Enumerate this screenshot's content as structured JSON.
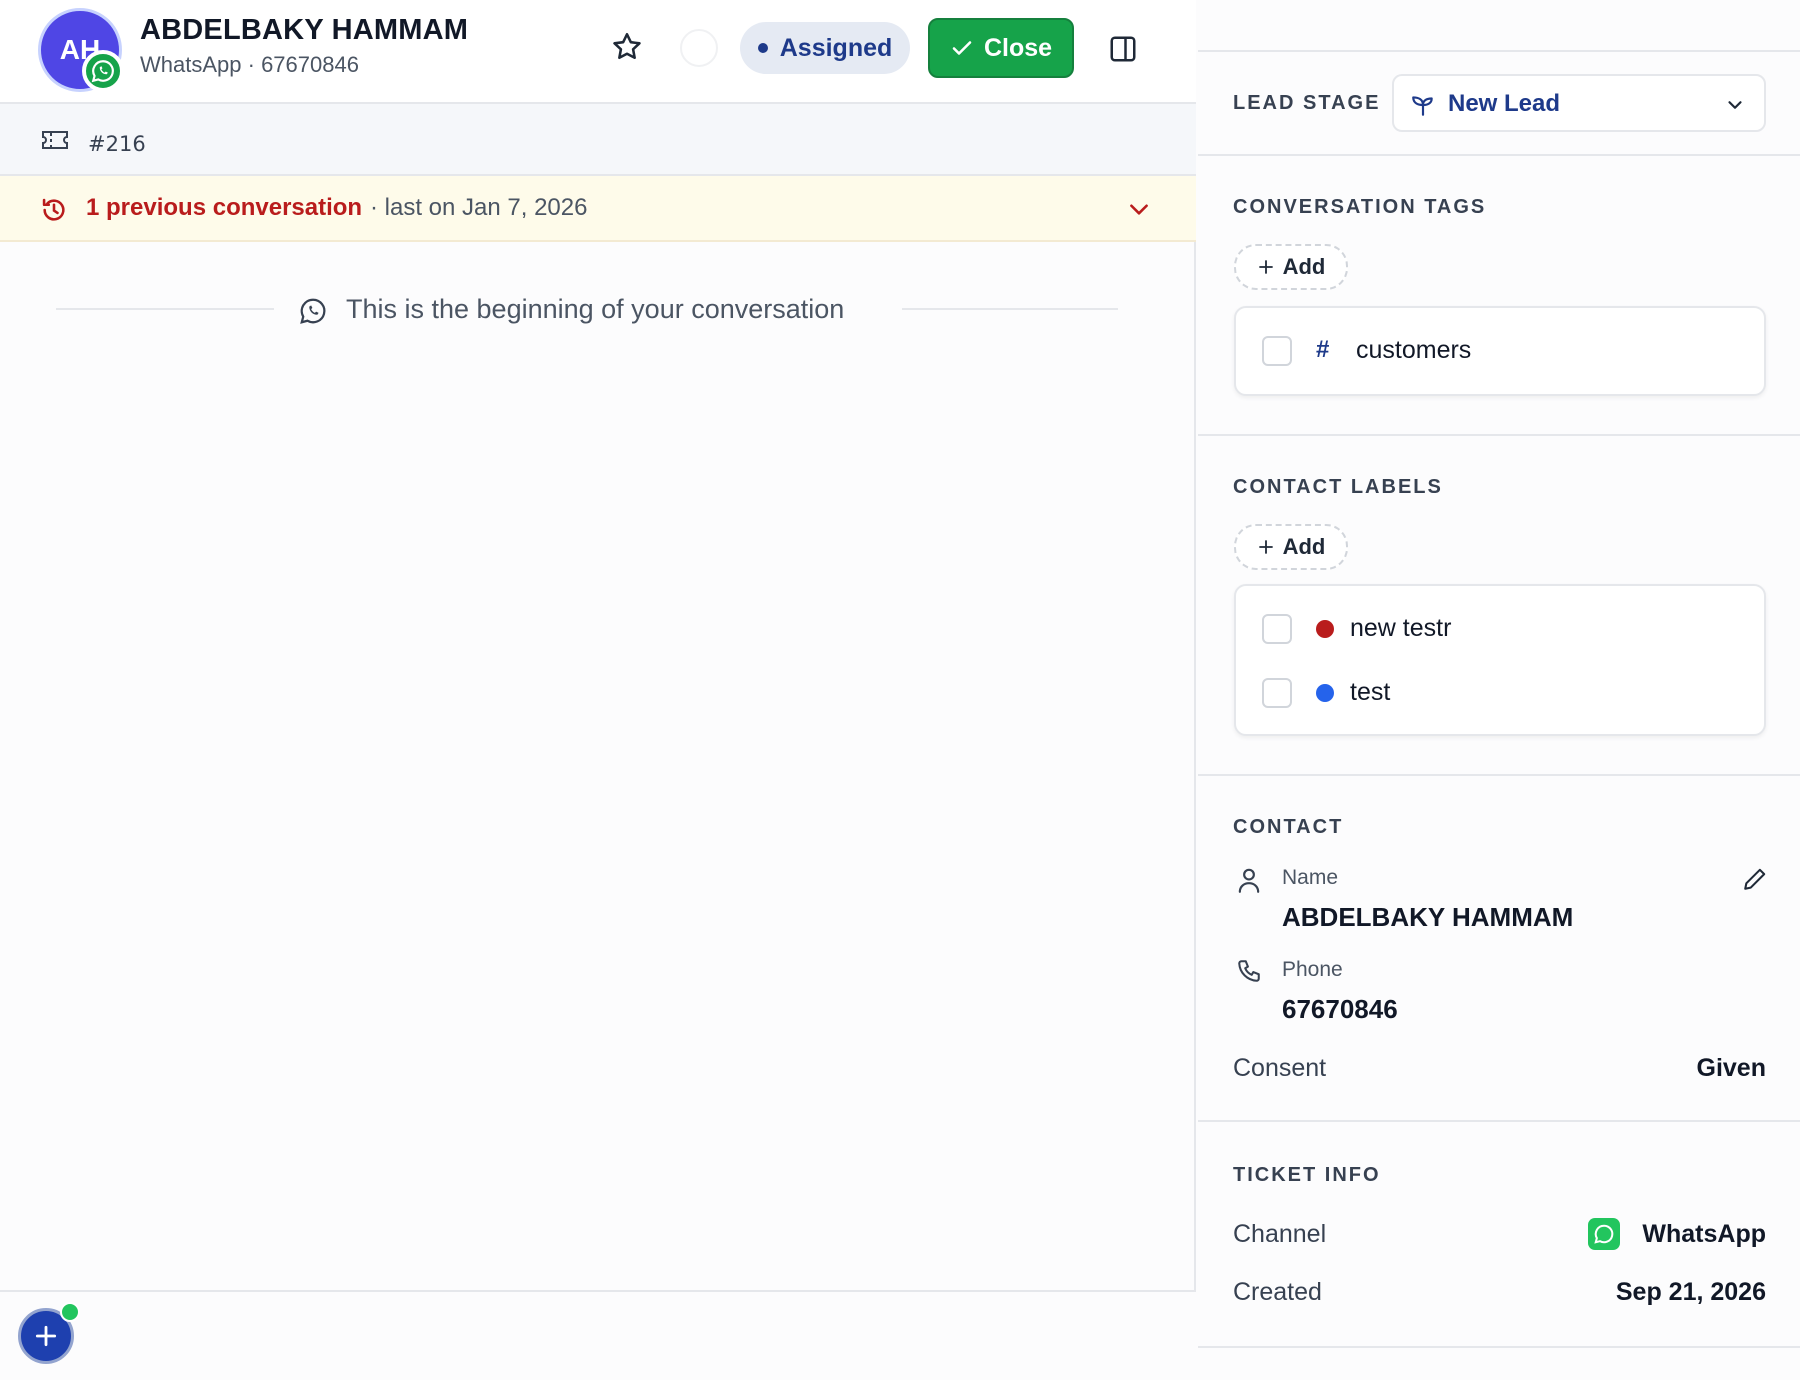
{
  "header": {
    "avatar_initials": "AH",
    "contact_name": "ABDELBAKY HAMMAM",
    "contact_channel": "WhatsApp",
    "contact_phone": "67670846",
    "assigned_label": "Assigned",
    "close_label": "Close"
  },
  "ticket": {
    "number": "#216"
  },
  "previous": {
    "title": "1 previous conversation",
    "subtitle": "· last on Jan 7, 2026"
  },
  "conversation": {
    "beginning_text": "This is the beginning of your conversation"
  },
  "sidebar": {
    "lead_stage": {
      "title": "LEAD STAGE",
      "value": "New Lead"
    },
    "conversation_tags": {
      "title": "CONVERSATION TAGS",
      "add_label": "Add",
      "items": [
        {
          "symbol": "#",
          "label": "customers"
        }
      ]
    },
    "contact_labels": {
      "title": "CONTACT LABELS",
      "add_label": "Add",
      "items": [
        {
          "label": "new testr",
          "color": "#b91c1c"
        },
        {
          "label": "test",
          "color": "#2563eb"
        }
      ]
    },
    "contact": {
      "title": "CONTACT",
      "name_label": "Name",
      "name_value": "ABDELBAKY HAMMAM",
      "phone_label": "Phone",
      "phone_value": "67670846",
      "consent_label": "Consent",
      "consent_value": "Given"
    },
    "ticket_info": {
      "title": "TICKET INFO",
      "channel_label": "Channel",
      "channel_value": "WhatsApp",
      "created_label": "Created",
      "created_value": "Sep 21, 2026"
    }
  },
  "colors": {
    "accent": "#1e3a8a",
    "close_green": "#16a34a",
    "warning_red": "#b91c1c",
    "whatsapp_green": "#22c55e"
  }
}
